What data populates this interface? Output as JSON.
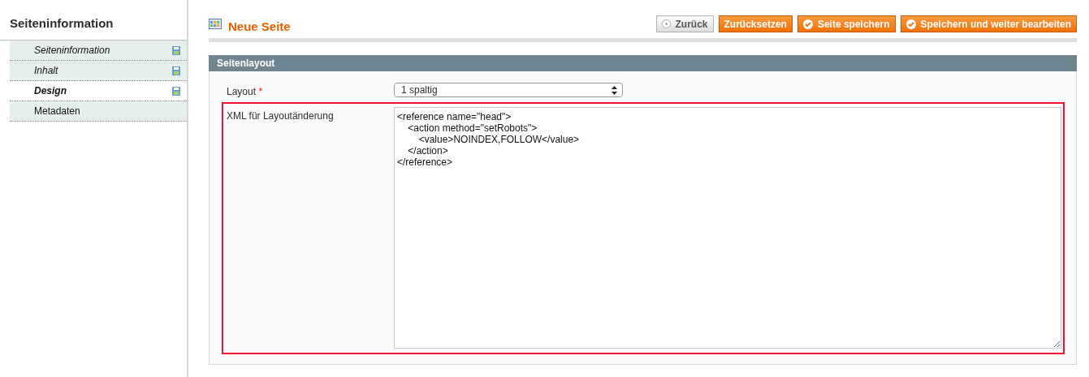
{
  "sidebar": {
    "title": "Seiteninformation",
    "items": [
      {
        "label": "Seiteninformation",
        "selected": false,
        "changed": true
      },
      {
        "label": "Inhalt",
        "selected": false,
        "changed": true
      },
      {
        "label": "Design",
        "selected": true,
        "changed": true
      },
      {
        "label": "Metadaten",
        "selected": false,
        "changed": false
      }
    ]
  },
  "header": {
    "title": "Neue Seite",
    "buttons": [
      {
        "label": "Zurück",
        "kind": "back"
      },
      {
        "label": "Zurücksetzen",
        "kind": "reset"
      },
      {
        "label": "Seite speichern",
        "kind": "save"
      },
      {
        "label": "Speichern und weiter bearbeiten",
        "kind": "save"
      }
    ]
  },
  "section": {
    "title": "Seitenlayout",
    "fields": [
      {
        "label": "Layout",
        "required_mark": "*",
        "kind": "select",
        "value": "1 spaltig",
        "highlighted": false
      },
      {
        "label": "XML für Layoutänderung",
        "kind": "textarea",
        "value": "<reference name=\"head\">\n    <action method=\"setRobots\">\n        <value>NOINDEX,FOLLOW</value>\n    </action>\n</reference>",
        "highlighted": true
      }
    ]
  }
}
